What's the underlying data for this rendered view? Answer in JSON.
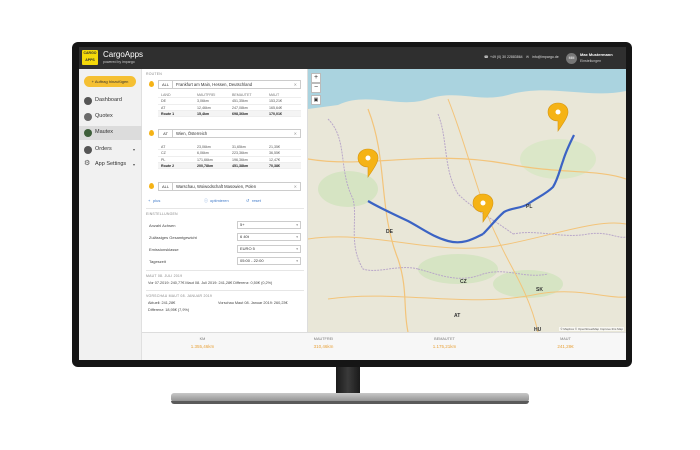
{
  "app": {
    "logo_text": "CARGO APPS",
    "title": "CargoApps",
    "subtitle": "powered by impargo",
    "phone": "+49 (0) 30 22883864",
    "email": "info@impargo.de",
    "user_initials": "MM",
    "user_name": "Max Mustermann",
    "user_link": "Einstellungen"
  },
  "sidebar": {
    "add_button": "+ Auftrag hinzufügen",
    "items": [
      {
        "label": "Dashboard",
        "icon": "dashboard-icon"
      },
      {
        "label": "Quotex",
        "icon": "quotex-icon"
      },
      {
        "label": "Mautex",
        "icon": "mautex-icon"
      },
      {
        "label": "Orders",
        "icon": "orders-icon"
      },
      {
        "label": "App Settings",
        "icon": "settings-icon"
      }
    ]
  },
  "routes": {
    "section_label": "ROUTEN",
    "col_headers": [
      "LAND",
      "MAUTFREI",
      "BEMAUTET",
      "MAUT"
    ],
    "legs": [
      {
        "select": "ALL",
        "address": "Frankfurt am Main, Hessen, Deutschland",
        "rows": [
          [
            "DE",
            "3,06km",
            "451,35km",
            "153,21€"
          ],
          [
            "AT",
            "12,46km",
            "247,08km",
            "165,64€"
          ]
        ],
        "total": [
          "Route 1",
          "15,4km",
          "698,36km",
          "170,01€"
        ]
      },
      {
        "select": "AT",
        "address": "Wien, Österreich",
        "rows": [
          [
            "AT",
            "23,06km",
            "31,65km",
            "21,35€"
          ],
          [
            "CZ",
            "6,06km",
            "223,36km",
            "36,55€"
          ],
          [
            "PL",
            "171,66km",
            "196,36km",
            "12,47€"
          ]
        ],
        "total": [
          "Route 2",
          "200,78km",
          "451,38km",
          "70,38€"
        ]
      },
      {
        "select": "ALL",
        "address": "Warschau, Woiwodschaft Masowien, Polen"
      }
    ],
    "link_plus": "plus",
    "link_optimize": "optimieren",
    "link_reset": "reset"
  },
  "settings": {
    "section_label": "EINSTELLUNGEN",
    "rows": [
      {
        "label": "Anzahl Achsen",
        "value": "5+"
      },
      {
        "label": "Zulässiges Gesamtgewicht",
        "value": "6 40t"
      },
      {
        "label": "Emissionsklasse",
        "value": "EURO 5"
      },
      {
        "label": "Tageszeit",
        "value": "05:00 - 22:00"
      }
    ]
  },
  "maut": {
    "current_label": "MAUT 08. JULI 2019",
    "current_line": "Vor 07.2019: 240,77€  Maut 08. Juli 2019: 241,28€  Differenz: 0,50€ (0,2%)",
    "preview_label": "VORSCHAU MAUT 08. JANUAR 2019",
    "preview_current": "Aktuell: 241,28€",
    "preview_future": "Vorschau Maut 08. Januar 2019: 260,23€",
    "preview_diff": "Differenz: 18,95€ (7,9%)"
  },
  "map": {
    "labels": [
      "DE",
      "PL",
      "CZ",
      "AT",
      "SK",
      "HU"
    ],
    "attribution": "© Mapbox © OpenStreetMap Improve this Map",
    "accent_route": "#3b63c4",
    "pin_color": "#f5b316"
  },
  "footer": {
    "cols": [
      {
        "title": "KM",
        "value": "1.355,46km"
      },
      {
        "title": "MAUTFREI",
        "value": "310,46km"
      },
      {
        "title": "BEMAUTET",
        "value": "1.175,21km"
      },
      {
        "title": "MAUT",
        "value": "241,28€"
      }
    ]
  }
}
